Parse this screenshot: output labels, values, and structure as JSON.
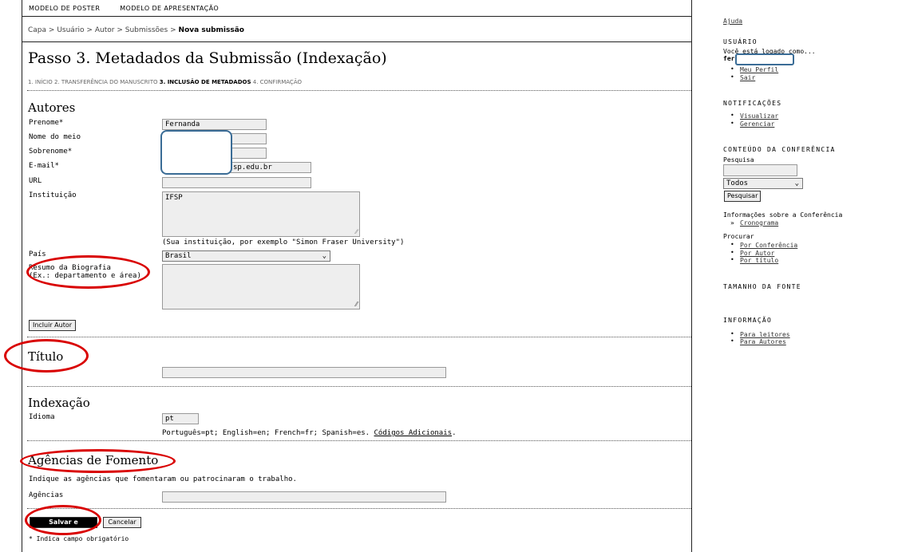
{
  "topnav": {
    "item1": "MODELO DE POSTER",
    "item2": "MODELO DE APRESENTAÇÃO"
  },
  "breadcrumb": {
    "b1": "Capa",
    "b2": "Usuário",
    "b3": "Autor",
    "b4": "Submissões",
    "current": "Nova submissão",
    "sep": ">"
  },
  "page": {
    "title": "Passo 3. Metadados da Submissão (Indexação)"
  },
  "steps": {
    "s1": "1. INÍCIO",
    "s2": "2. TRANSFERÊNCIA DO MANUSCRITO",
    "s3": "3. INCLUSÃO DE METADADOS",
    "s4": "4. CONFIRMAÇÃO"
  },
  "authors": {
    "heading": "Autores",
    "firstname_label": "Prenome*",
    "firstname_value": "Fernanda",
    "middlename_label": "Nome do meio",
    "lastname_label": "Sobrenome*",
    "email_label": "E-mail*",
    "email_value": "sp.edu.br",
    "url_label": "URL",
    "institution_label": "Instituição",
    "institution_value": "IFSP",
    "institution_hint": "(Sua instituição, por exemplo \"Simon Fraser University\")",
    "country_label": "País",
    "country_value": "Brasil",
    "bio_label_1": "Resumo da Biografia",
    "bio_label_2": "(Ex.: departamento e área)",
    "add_author_button": "Incluir Autor"
  },
  "title_section": {
    "heading": "Título",
    "field_label": "Título"
  },
  "indexing": {
    "heading": "Indexação",
    "language_label": "Idioma",
    "language_value": "pt",
    "language_hint": "Português=pt; English=en; French=fr; Spanish=es.",
    "language_link": "Códigos Adicionais"
  },
  "funding": {
    "heading": "Agências de Fomento",
    "description": "Indique as agências que fomentaram ou patrocinaram o trabalho.",
    "agencies_label": "Agências"
  },
  "actions": {
    "save_button": "Salvar e continuar",
    "cancel_button": "Cancelar",
    "required_note": "* Indica campo obrigatório"
  },
  "sidebar": {
    "help": "Ajuda",
    "user_heading": "USUÁRIO",
    "logged_as": "Você está logado como...",
    "username": "fer",
    "my_profile": "Meu Perfil",
    "logout": "Sair",
    "notif_heading": "NOTIFICAÇÕES",
    "notif_view": "Visualizar",
    "notif_manage": "Gerenciar",
    "content_heading": "CONTEÚDO DA CONFERÊNCIA",
    "search_label": "Pesquisa",
    "search_scope": "Todos",
    "search_button": "Pesquisar",
    "info_label": "Informações sobre a Conferência",
    "schedule": "Cronograma",
    "browse_label": "Procurar",
    "by_conference": "Por Conferência",
    "by_author": "Por Autor",
    "by_title": "Por título",
    "font_heading": "TAMANHO DA FONTE",
    "info_heading": "INFORMAÇÃO",
    "for_readers": "Para leitores",
    "for_authors": "Para Autores"
  }
}
